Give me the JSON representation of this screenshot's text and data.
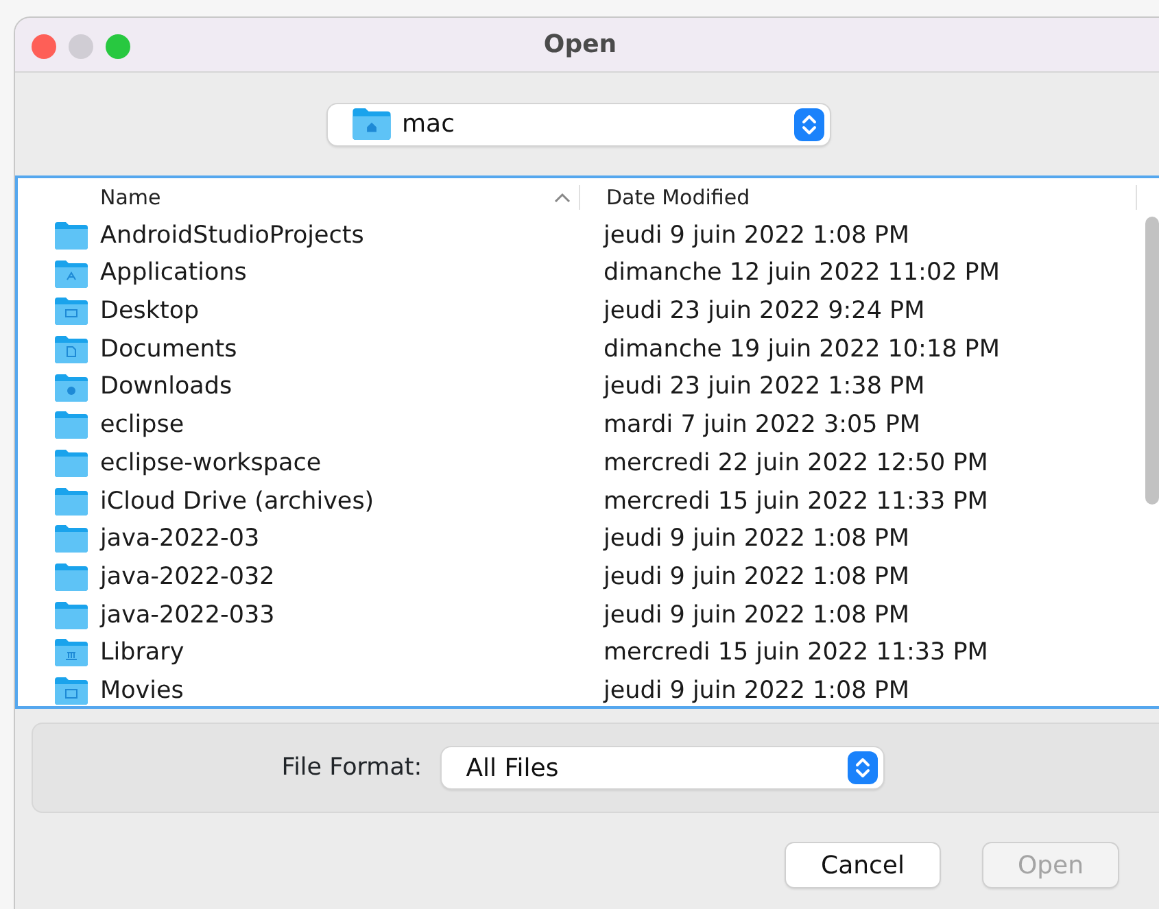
{
  "window": {
    "title": "Open"
  },
  "location": {
    "label": "mac"
  },
  "table": {
    "columns": [
      {
        "label": "Name",
        "sorted": true
      },
      {
        "label": "Date Modified",
        "sorted": false
      }
    ],
    "rows": [
      {
        "kind": "folder",
        "name": "AndroidStudioProjects",
        "date": "jeudi 9 juin 2022 1:08 PM"
      },
      {
        "kind": "applications",
        "name": "Applications",
        "date": "dimanche 12 juin 2022 11:02 PM"
      },
      {
        "kind": "desktop",
        "name": "Desktop",
        "date": "jeudi 23 juin 2022 9:24 PM"
      },
      {
        "kind": "documents",
        "name": "Documents",
        "date": "dimanche 19 juin 2022 10:18 PM"
      },
      {
        "kind": "downloads",
        "name": "Downloads",
        "date": "jeudi 23 juin 2022 1:38 PM"
      },
      {
        "kind": "folder",
        "name": "eclipse",
        "date": "mardi 7 juin 2022 3:05 PM"
      },
      {
        "kind": "folder",
        "name": "eclipse-workspace",
        "date": "mercredi 22 juin 2022 12:50 PM"
      },
      {
        "kind": "folder",
        "name": "iCloud Drive (archives)",
        "date": "mercredi 15 juin 2022 11:33 PM"
      },
      {
        "kind": "folder",
        "name": "java-2022-03",
        "date": "jeudi 9 juin 2022 1:08 PM"
      },
      {
        "kind": "folder",
        "name": "java-2022-032",
        "date": "jeudi 9 juin 2022 1:08 PM"
      },
      {
        "kind": "folder",
        "name": "java-2022-033",
        "date": "jeudi 9 juin 2022 1:08 PM"
      },
      {
        "kind": "library",
        "name": "Library",
        "date": "mercredi 15 juin 2022 11:33 PM"
      },
      {
        "kind": "movies",
        "name": "Movies",
        "date": "jeudi 9 juin 2022 1:08 PM"
      }
    ]
  },
  "file_format": {
    "label": "File Format:",
    "value": "All Files"
  },
  "buttons": [
    {
      "label": "Cancel",
      "disabled": false
    },
    {
      "label": "Open",
      "disabled": true
    }
  ]
}
